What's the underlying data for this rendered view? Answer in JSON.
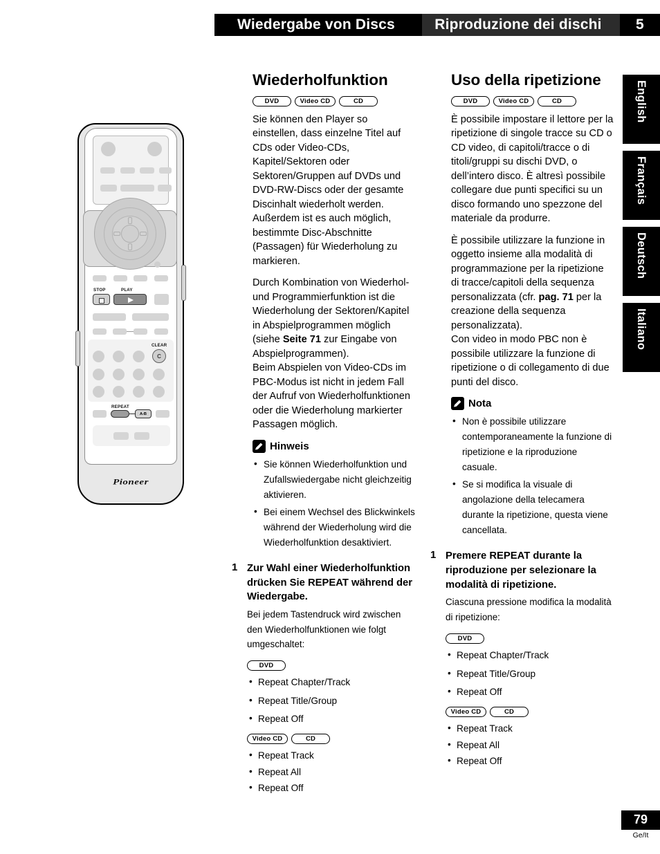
{
  "header": {
    "german_title": "Wiedergabe von Discs",
    "italian_title": "Riproduzione dei dischi",
    "chapter_number": "5",
    "bg_black": "#000000",
    "bg_grey": "#2c2c2c"
  },
  "language_tabs": [
    {
      "label": "English"
    },
    {
      "label": "Français"
    },
    {
      "label": "Deutsch"
    },
    {
      "label": "Italiano"
    }
  ],
  "footer": {
    "page_number": "79",
    "page_language": "Ge/It"
  },
  "badges": {
    "dvd": "DVD",
    "video_cd": "Video CD",
    "cd": "CD"
  },
  "german": {
    "heading": "Wiederholfunktion",
    "paragraphs": [
      "Sie können den Player so einstellen, dass einzelne Titel auf CDs oder Video-CDs, Kapitel/Sektoren oder Sektoren/Gruppen auf DVDs und DVD-RW-Discs oder der gesamte Discinhalt wiederholt werden. Außerdem ist es auch möglich, bestimmte Disc-Abschnitte (Passagen) für Wiederholung zu markieren.",
      "Durch Kombination von Wiederhol- und Programmierfunktion ist die Wiederholung der Sektoren/Kapitel in Abspielprogrammen möglich (siehe ",
      "Beim Abspielen von Video-CDs im PBC-Modus ist nicht in jedem Fall der Aufruf von Wiederholfunktionen oder die Wiederholung markierter Passagen möglich."
    ],
    "page_ref_bold": "Seite 71",
    "para2_tail": " zur Eingabe von Abspielprogrammen).",
    "note_title": "Hinweis",
    "notes": [
      "Sie können Wiederholfunktion und Zufallswiedergabe nicht gleichzeitig aktivieren.",
      "Bei einem Wechsel des Blickwinkels während der Wiederholung wird die Wiederholfunktion desaktiviert."
    ],
    "step_number": "1",
    "step_title": "Zur Wahl einer Wiederholfunktion drücken Sie REPEAT während der Wiedergabe.",
    "step_sub": "Bei jedem Tastendruck wird zwischen den Wiederholfunktionen wie folgt umgeschaltet:",
    "dvd_modes": [
      "Repeat Chapter/Track",
      "Repeat Title/Group",
      "Repeat Off"
    ],
    "cd_modes": [
      "Repeat Track",
      "Repeat All",
      "Repeat Off"
    ]
  },
  "italian": {
    "heading": "Uso della ripetizione",
    "paragraphs": [
      "È possibile impostare il lettore per la ripetizione di singole tracce su CD o CD video, di capitoli/tracce o di titoli/gruppi su dischi DVD, o dell’intero disco. È altresì possibile collegare due punti specifici su un disco formando uno spezzone del materiale da produrre.",
      "È possibile utilizzare la funzione in oggetto insieme alla modalità di programmazione per la ripetizione di tracce/capitoli della sequenza personalizzata (cfr. ",
      "Con video in modo PBC non è possibile utilizzare la funzione di ripetizione o di collegamento di due punti del disco."
    ],
    "page_ref_bold": "pag. 71",
    "para2_tail": " per la creazione della sequenza personalizzata).",
    "note_title": "Nota",
    "notes": [
      "Non è possibile utilizzare contemporaneamente la funzione di ripetizione e la riproduzione casuale.",
      "Se si modifica la visuale di angolazione della telecamera durante la ripetizione, questa viene cancellata."
    ],
    "step_number": "1",
    "step_title": "Premere REPEAT durante la riproduzione per selezionare la modalità di ripetizione.",
    "step_sub": "Ciascuna pressione modifica la modalità di ripetizione:",
    "dvd_modes": [
      "Repeat Chapter/Track",
      "Repeat Title/Group",
      "Repeat Off"
    ],
    "cd_modes": [
      "Repeat Track",
      "Repeat All",
      "Repeat Off"
    ]
  },
  "remote": {
    "stop_label": "STOP",
    "play_label": "PLAY",
    "clear_label": "CLEAR",
    "clear_glyph": "C",
    "repeat_label": "REPEAT",
    "ab_label": "A-B",
    "brand": "Pioneer"
  }
}
